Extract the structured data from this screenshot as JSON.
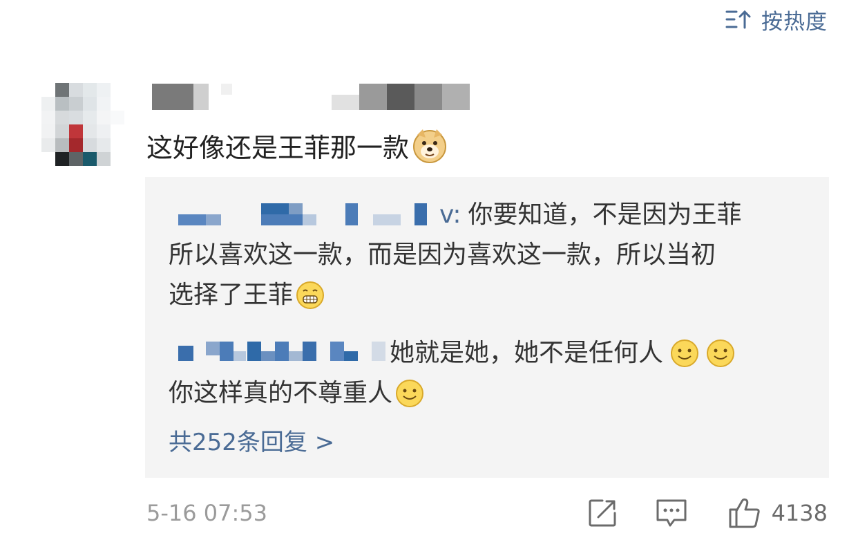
{
  "sort": {
    "label": "按热度",
    "icon": "sort-icon"
  },
  "comment": {
    "text": "这好像还是王菲那一款",
    "emoji": "doge-emoji",
    "timestamp": "5-16 07:53"
  },
  "replies": {
    "reply1": {
      "visible_author_fragment": "v:",
      "text_line1": "你要知道，不是因为王菲",
      "text_line2": "所以喜欢这一款，而是因为喜欢这一款，所以当初",
      "text_line3": "选择了王菲",
      "emoji": "grin-emoji"
    },
    "reply2": {
      "text_line1": "她就是她，她不是任何人",
      "text_line2": "你这样真的不尊重人",
      "emoji": "smile-emoji"
    },
    "more_label": "共252条回复 >"
  },
  "actions": {
    "share_icon": "share-icon",
    "comment_icon": "comment-icon",
    "like_icon": "like-icon",
    "like_count": "4138"
  },
  "colors": {
    "link": "#4a6b95",
    "reply_bg": "#f4f4f4",
    "muted": "#9b9b9b"
  }
}
